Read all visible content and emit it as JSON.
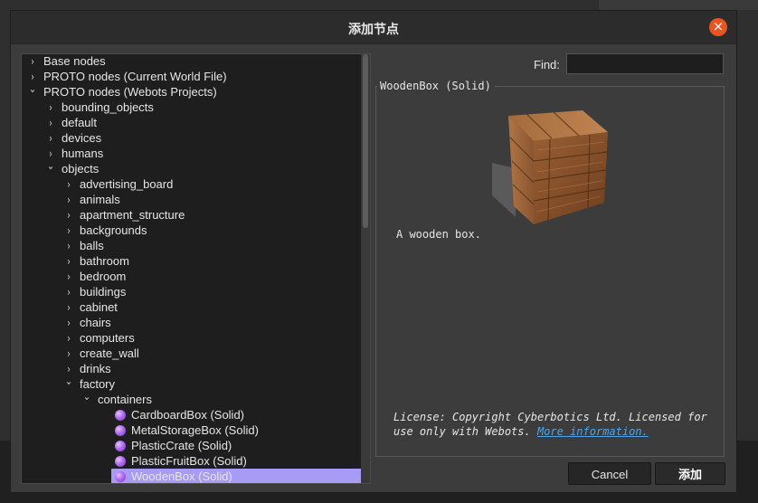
{
  "dialog": {
    "title": "添加节点",
    "close_icon": "close-icon"
  },
  "tree": {
    "items": [
      {
        "label": "Base nodes",
        "level": 0,
        "expanded": false
      },
      {
        "label": "PROTO nodes (Current World File)",
        "level": 0,
        "expanded": false
      },
      {
        "label": "PROTO nodes (Webots Projects)",
        "level": 0,
        "expanded": true
      },
      {
        "label": "bounding_objects",
        "level": 1,
        "expanded": false
      },
      {
        "label": "default",
        "level": 1,
        "expanded": false
      },
      {
        "label": "devices",
        "level": 1,
        "expanded": false
      },
      {
        "label": "humans",
        "level": 1,
        "expanded": false
      },
      {
        "label": "objects",
        "level": 1,
        "expanded": true
      },
      {
        "label": "advertising_board",
        "level": 2,
        "expanded": false
      },
      {
        "label": "animals",
        "level": 2,
        "expanded": false
      },
      {
        "label": "apartment_structure",
        "level": 2,
        "expanded": false
      },
      {
        "label": "backgrounds",
        "level": 2,
        "expanded": false
      },
      {
        "label": "balls",
        "level": 2,
        "expanded": false
      },
      {
        "label": "bathroom",
        "level": 2,
        "expanded": false
      },
      {
        "label": "bedroom",
        "level": 2,
        "expanded": false
      },
      {
        "label": "buildings",
        "level": 2,
        "expanded": false
      },
      {
        "label": "cabinet",
        "level": 2,
        "expanded": false
      },
      {
        "label": "chairs",
        "level": 2,
        "expanded": false
      },
      {
        "label": "computers",
        "level": 2,
        "expanded": false
      },
      {
        "label": "create_wall",
        "level": 2,
        "expanded": false
      },
      {
        "label": "drinks",
        "level": 2,
        "expanded": false
      },
      {
        "label": "factory",
        "level": 2,
        "expanded": true
      },
      {
        "label": "containers",
        "level": 3,
        "expanded": true
      },
      {
        "label": "CardboardBox (Solid)",
        "level": 4,
        "leaf": true
      },
      {
        "label": "MetalStorageBox (Solid)",
        "level": 4,
        "leaf": true
      },
      {
        "label": "PlasticCrate (Solid)",
        "level": 4,
        "leaf": true
      },
      {
        "label": "PlasticFruitBox (Solid)",
        "level": 4,
        "leaf": true
      },
      {
        "label": "WoodenBox (Solid)",
        "level": 4,
        "leaf": true,
        "selected": true
      }
    ],
    "selection_color": "#a79bf5"
  },
  "find": {
    "label": "Find:",
    "value": ""
  },
  "info": {
    "title": "WoodenBox (Solid)",
    "description": "A wooden box.",
    "license_text": "License: Copyright Cyberbotics Ltd. Licensed for use only with Webots.",
    "license_link": "More information."
  },
  "buttons": {
    "cancel": "Cancel",
    "add": "添加"
  },
  "colors": {
    "accent_close": "#e95420",
    "link": "#4ea3e8"
  }
}
